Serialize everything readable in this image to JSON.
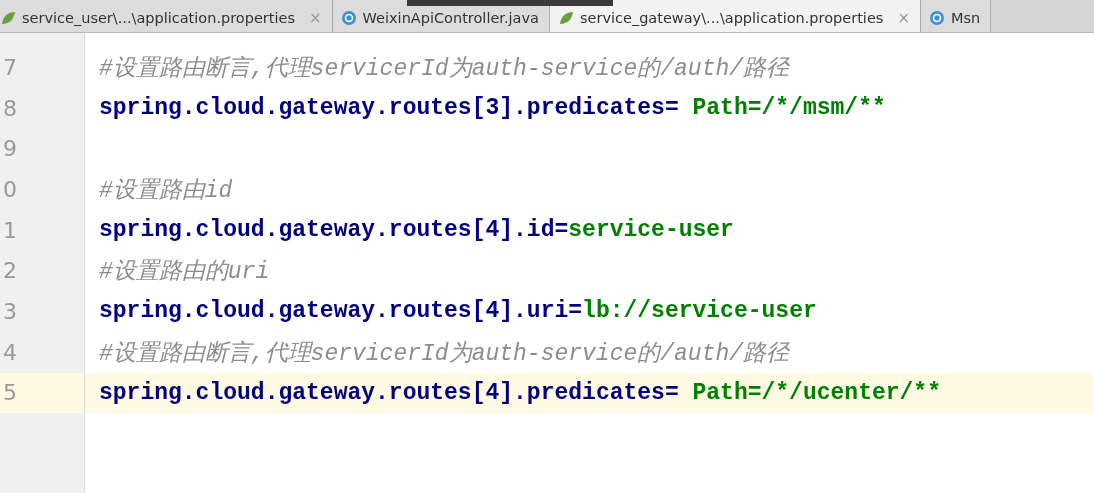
{
  "tabs": [
    {
      "label": "service_user\\...\\application.properties",
      "kind": "properties",
      "closable": true,
      "selected": false
    },
    {
      "label": "WeixinApiController.java",
      "kind": "java",
      "closable": false,
      "selected": false
    },
    {
      "label": "service_gateway\\...\\application.properties",
      "kind": "properties",
      "closable": true,
      "selected": true
    },
    {
      "label": "Msn",
      "kind": "java",
      "closable": false,
      "selected": false
    }
  ],
  "close_glyph": "×",
  "editor": {
    "lines": [
      {
        "kind": "blank",
        "current": false
      },
      {
        "number": "7",
        "kind": "comment",
        "text": "#设置路由断言,代理servicerId为auth-service的/auth/路径",
        "current": false
      },
      {
        "number": "8",
        "kind": "property",
        "key": "spring.cloud.gateway.routes[3].predicates=",
        "value": " Path=/*/msm/**",
        "current": false
      },
      {
        "number": "9",
        "kind": "blank",
        "current": false
      },
      {
        "number": "0",
        "kind": "comment",
        "text": "#设置路由id",
        "current": false
      },
      {
        "number": "1",
        "kind": "property",
        "key": "spring.cloud.gateway.routes[4].id=",
        "value": "service-user",
        "current": false
      },
      {
        "number": "2",
        "kind": "comment",
        "text": "#设置路由的uri",
        "current": false
      },
      {
        "number": "3",
        "kind": "property",
        "key": "spring.cloud.gateway.routes[4].uri=",
        "value": "lb://service-user",
        "current": false
      },
      {
        "number": "4",
        "kind": "comment",
        "text": "#设置路由断言,代理servicerId为auth-service的/auth/路径",
        "current": false
      },
      {
        "number": "5",
        "kind": "property",
        "key": "spring.cloud.gateway.routes[4].predicates=",
        "value": " Path=/*/ucenter/**",
        "current": true
      }
    ]
  }
}
